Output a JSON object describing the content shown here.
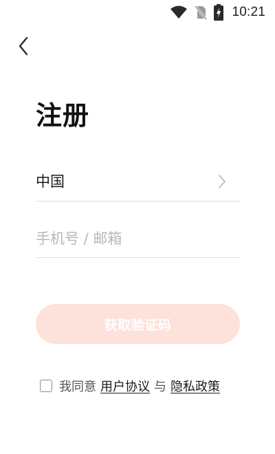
{
  "status_bar": {
    "time": "10:21",
    "icons": [
      "wifi-icon",
      "no-sim-icon",
      "battery-charging-icon"
    ]
  },
  "nav": {
    "back_icon": "chevron-left-icon"
  },
  "page": {
    "title": "注册"
  },
  "country": {
    "label": "中国",
    "icon": "chevron-right-icon"
  },
  "account_input": {
    "value": "",
    "placeholder": "手机号 / 邮箱"
  },
  "get_code": {
    "label": "获取验证码",
    "color": "#fde2dc"
  },
  "agreement": {
    "checked": false,
    "prefix": "我同意",
    "user_agreement": "用户协议",
    "conjunction": "与",
    "privacy_policy": "隐私政策"
  }
}
